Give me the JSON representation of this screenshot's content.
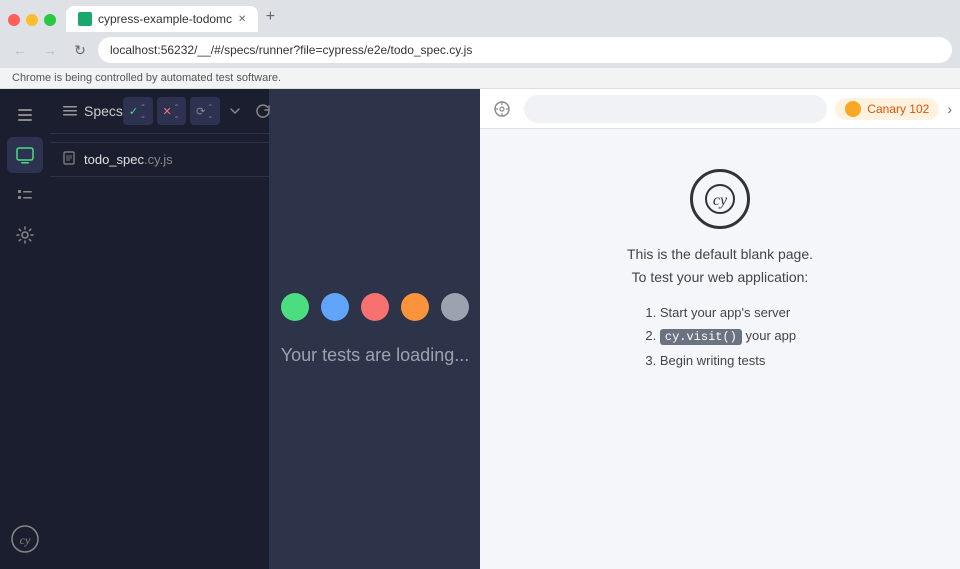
{
  "browser": {
    "tab_title": "cypress-example-todomc",
    "address": "localhost:56232/__/#/specs/runner?file=cypress/e2e/todo_spec.cy.js",
    "info_bar": "Chrome is being controlled by automated test software.",
    "back_btn": "←",
    "forward_btn": "→",
    "refresh_btn": "↻"
  },
  "sidebar": {
    "icons": [
      {
        "name": "specs-icon",
        "label": "≡",
        "active": false
      },
      {
        "name": "run-icon",
        "label": "▶",
        "active": true
      },
      {
        "name": "list-icon",
        "label": "☰",
        "active": false
      },
      {
        "name": "settings-icon",
        "label": "⚙",
        "active": false
      }
    ],
    "cy_logo": "cy"
  },
  "specs_panel": {
    "title": "Specs",
    "toolbar": {
      "check": "✓",
      "dash1": "--",
      "x": "✕",
      "dash2": "--",
      "spinner": "⟳",
      "dash3": "--"
    },
    "spec": {
      "name": "todo_spec",
      "ext": ".cy.js"
    }
  },
  "runner": {
    "loading_text": "Your tests are loading...",
    "dots": [
      {
        "color": "#4ade80"
      },
      {
        "color": "#60a5fa"
      },
      {
        "color": "#f87171"
      },
      {
        "color": "#fb923c"
      },
      {
        "color": "#9ca3af"
      }
    ]
  },
  "preview": {
    "browser_name": "Canary 102",
    "blank_page_line1": "This is the default blank page.",
    "blank_page_line2": "To test your web application:",
    "steps": [
      "Start your app's server",
      "cy.visit() your app",
      "Begin writing tests"
    ],
    "code_badge": "cy.visit()"
  }
}
